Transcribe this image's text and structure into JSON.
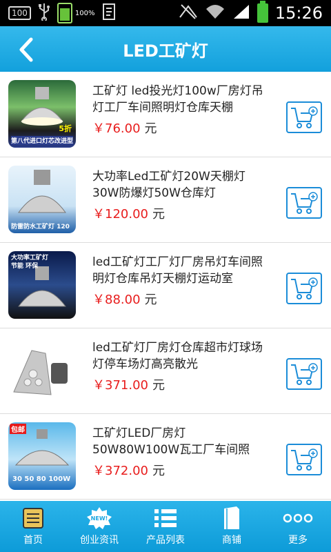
{
  "statusbar": {
    "badge": "100",
    "battery_small_pct": "100%",
    "time": "15:26",
    "icons": [
      "usb-icon",
      "document-icon",
      "no-sim-icon",
      "wifi-icon",
      "signal-icon",
      "battery-icon"
    ]
  },
  "header": {
    "title": "LED工矿灯",
    "back_icon": "back-arrow-icon"
  },
  "products": [
    {
      "name": "工矿灯 led投光灯100w厂房灯吊灯工厂车间照明灯仓库天棚",
      "price": "￥76.00",
      "unit": "元",
      "thumb_text_top": "5折",
      "thumb_text_bottom": "第八代进口灯芯改进型"
    },
    {
      "name": "大功率Led工矿灯20W天棚灯30W防爆灯50W仓库灯",
      "price": "￥120.00",
      "unit": "元",
      "thumb_text_top": "",
      "thumb_text_bottom": "防雷防水工矿灯 120"
    },
    {
      "name": "led工矿灯工厂灯厂房吊灯车间照明灯仓库吊灯天棚灯运动室",
      "price": "￥88.00",
      "unit": "元",
      "thumb_text_top": "大功率工矿灯 节能 环保",
      "thumb_text_bottom": ""
    },
    {
      "name": "led工矿灯厂房灯仓库超市灯球场灯停车场灯高亮散光",
      "price": "￥371.00",
      "unit": "元",
      "thumb_text_top": "",
      "thumb_text_bottom": ""
    },
    {
      "name": "工矿灯LED厂房灯50W80W100W瓦工厂车间照",
      "price": "￥372.00",
      "unit": "元",
      "thumb_text_top": "包邮",
      "thumb_text_bottom": "30 50 80 100W"
    }
  ],
  "cart_icon": "add-to-cart-icon",
  "bottom_nav": [
    {
      "label": "首页",
      "icon": "home-icon"
    },
    {
      "label": "创业资讯",
      "icon": "news-icon"
    },
    {
      "label": "产品列表",
      "icon": "list-icon"
    },
    {
      "label": "商铺",
      "icon": "shop-icon"
    },
    {
      "label": "更多",
      "icon": "more-icon"
    }
  ],
  "colors": {
    "accent": "#1aa6e0",
    "price": "#e81d1d",
    "cart_border": "#1a8cd8"
  }
}
